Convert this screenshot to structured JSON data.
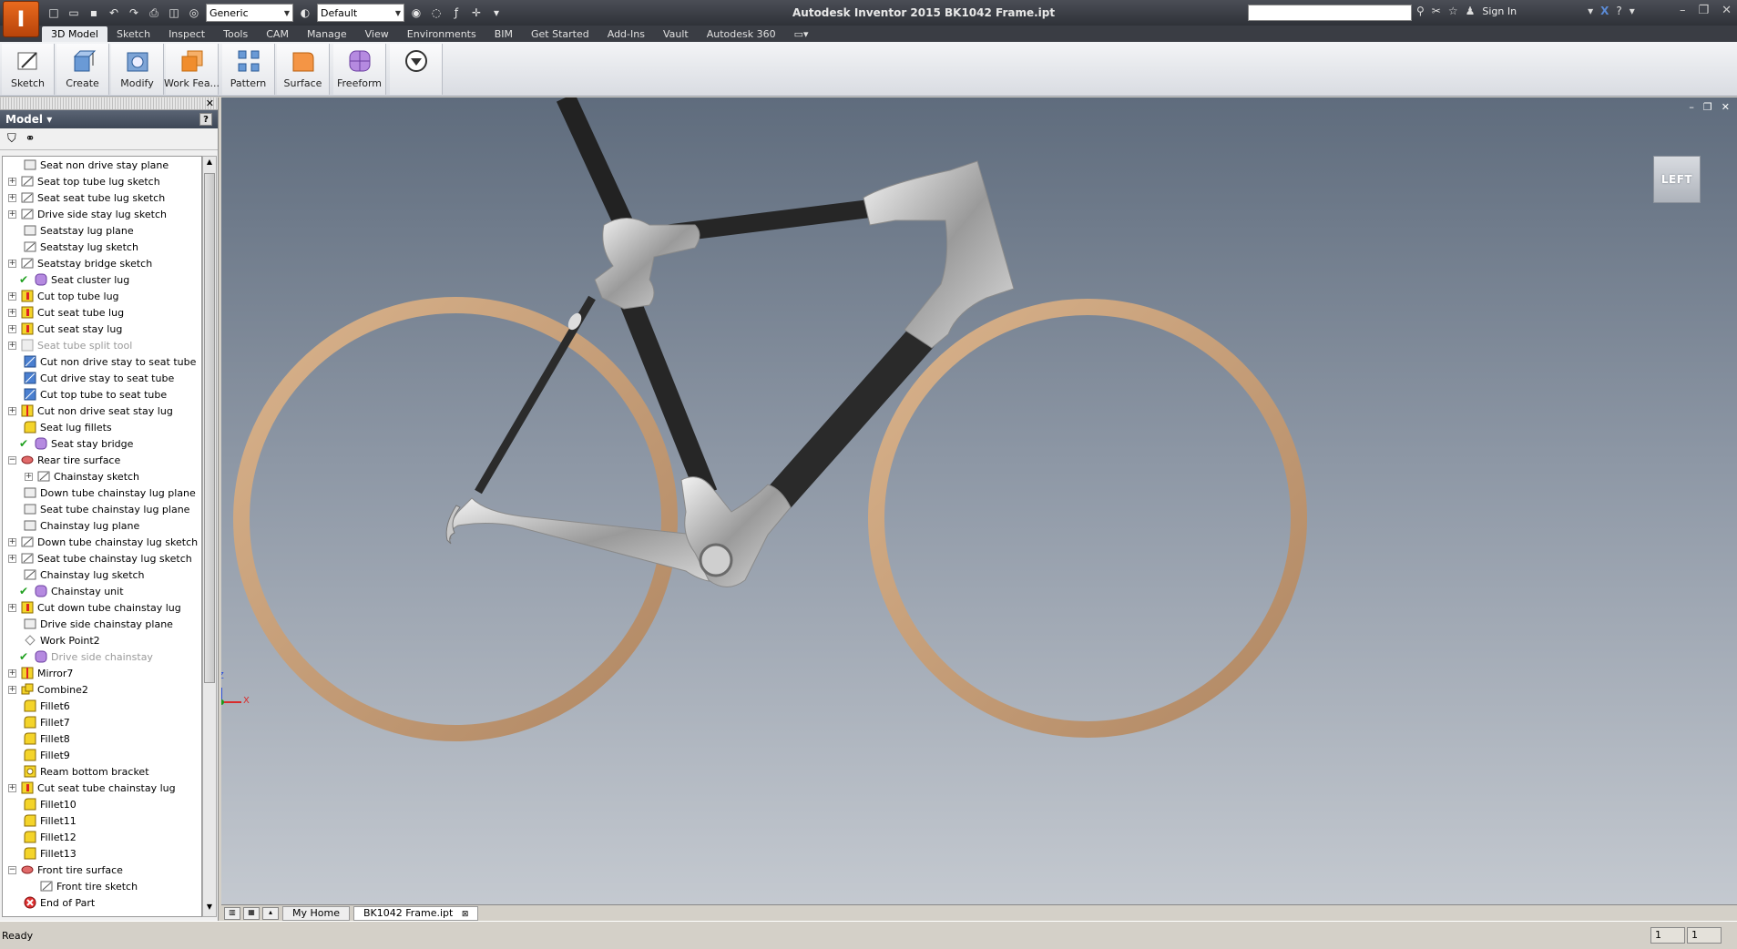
{
  "window": {
    "title": "Autodesk Inventor 2015   BK1042 Frame.ipt",
    "sign_in": "Sign In"
  },
  "quick_access": {
    "material": "Generic",
    "appearance": "Default",
    "icons": [
      "new-icon",
      "open-icon",
      "save-icon",
      "undo-icon",
      "redo-icon",
      "print-icon",
      "select-icon",
      "update-icon",
      "material-icon",
      "appearance-icon",
      "parameters-icon",
      "measure-icon",
      "customize-icon"
    ]
  },
  "tabs": [
    "3D Model",
    "Sketch",
    "Inspect",
    "Tools",
    "CAM",
    "Manage",
    "View",
    "Environments",
    "BIM",
    "Get Started",
    "Add-Ins",
    "Vault",
    "Autodesk 360"
  ],
  "active_tab": "3D Model",
  "ribbon": {
    "buttons": [
      {
        "label": "Sketch",
        "icon": "sketch-icon"
      },
      {
        "label": "Create",
        "icon": "create-icon"
      },
      {
        "label": "Modify",
        "icon": "modify-icon"
      },
      {
        "label": "Work Fea...",
        "icon": "work-features-icon"
      },
      {
        "label": "Pattern",
        "icon": "pattern-icon"
      },
      {
        "label": "Surface",
        "icon": "surface-icon"
      },
      {
        "label": "Freeform",
        "icon": "freeform-icon"
      },
      {
        "label": "",
        "icon": "more-icon"
      }
    ]
  },
  "browser": {
    "title": "Model",
    "items": [
      {
        "label": "Seat non drive stay plane",
        "icon": "plane-icon",
        "exp": "",
        "check": false,
        "dim": false
      },
      {
        "label": "Seat top tube lug sketch",
        "icon": "sketch-icon",
        "exp": "+",
        "check": false,
        "dim": false
      },
      {
        "label": "Seat seat tube lug sketch",
        "icon": "sketch-icon",
        "exp": "+",
        "check": false,
        "dim": false
      },
      {
        "label": "Drive side stay lug sketch",
        "icon": "sketch-icon",
        "exp": "+",
        "check": false,
        "dim": false
      },
      {
        "label": "Seatstay lug plane",
        "icon": "plane-icon",
        "exp": "",
        "check": false,
        "dim": false
      },
      {
        "label": "Seatstay lug sketch",
        "icon": "sketch-icon",
        "exp": "",
        "check": false,
        "dim": false
      },
      {
        "label": "Seatstay bridge sketch",
        "icon": "sketch-icon",
        "exp": "+",
        "check": false,
        "dim": false
      },
      {
        "label": "Seat cluster lug",
        "icon": "freeform-icon",
        "exp": "",
        "check": true,
        "dim": false
      },
      {
        "label": "Cut top tube lug",
        "icon": "cut-icon",
        "exp": "+",
        "check": false,
        "dim": false
      },
      {
        "label": "Cut seat tube lug",
        "icon": "cut-icon",
        "exp": "+",
        "check": false,
        "dim": false
      },
      {
        "label": "Cut seat stay lug",
        "icon": "cut-icon",
        "exp": "+",
        "check": false,
        "dim": false
      },
      {
        "label": "Seat tube split tool",
        "icon": "split-icon",
        "exp": "+",
        "check": false,
        "dim": true
      },
      {
        "label": "Cut non drive stay to seat tube",
        "icon": "split-cut-icon",
        "exp": "",
        "check": false,
        "dim": false
      },
      {
        "label": "Cut drive stay to seat tube",
        "icon": "split-cut-icon",
        "exp": "",
        "check": false,
        "dim": false
      },
      {
        "label": "Cut top tube to seat tube",
        "icon": "split-cut-icon",
        "exp": "",
        "check": false,
        "dim": false
      },
      {
        "label": "Cut non drive seat stay lug",
        "icon": "mirror-icon",
        "exp": "+",
        "check": false,
        "dim": false
      },
      {
        "label": "Seat lug fillets",
        "icon": "fillet-icon",
        "exp": "",
        "check": false,
        "dim": false
      },
      {
        "label": "Seat stay bridge",
        "icon": "freeform-icon",
        "exp": "",
        "check": true,
        "dim": false
      },
      {
        "label": "Rear tire surface",
        "icon": "revolve-icon",
        "exp": "-",
        "check": false,
        "dim": false
      },
      {
        "label": "Chainstay sketch",
        "icon": "sketch-icon",
        "exp": "+",
        "check": false,
        "dim": false,
        "indent": true
      },
      {
        "label": "Down tube chainstay lug plane",
        "icon": "plane-icon",
        "exp": "",
        "check": false,
        "dim": false
      },
      {
        "label": "Seat tube chainstay lug plane",
        "icon": "plane-icon",
        "exp": "",
        "check": false,
        "dim": false
      },
      {
        "label": "Chainstay lug plane",
        "icon": "plane-icon",
        "exp": "",
        "check": false,
        "dim": false
      },
      {
        "label": "Down tube chainstay lug sketch",
        "icon": "sketch-icon",
        "exp": "+",
        "check": false,
        "dim": false
      },
      {
        "label": "Seat tube chainstay lug sketch",
        "icon": "sketch-icon",
        "exp": "+",
        "check": false,
        "dim": false
      },
      {
        "label": "Chainstay lug sketch",
        "icon": "sketch-icon",
        "exp": "",
        "check": false,
        "dim": false
      },
      {
        "label": "Chainstay unit",
        "icon": "freeform-icon",
        "exp": "",
        "check": true,
        "dim": false
      },
      {
        "label": "Cut down tube chainstay lug",
        "icon": "cut-icon",
        "exp": "+",
        "check": false,
        "dim": false
      },
      {
        "label": "Drive side chainstay plane",
        "icon": "plane-icon",
        "exp": "",
        "check": false,
        "dim": false
      },
      {
        "label": "Work Point2",
        "icon": "workpoint-icon",
        "exp": "",
        "check": false,
        "dim": false
      },
      {
        "label": "Drive side chainstay",
        "icon": "freeform-icon",
        "exp": "",
        "check": true,
        "dim": true
      },
      {
        "label": "Mirror7",
        "icon": "mirror-icon",
        "exp": "+",
        "check": false,
        "dim": false
      },
      {
        "label": "Combine2",
        "icon": "combine-icon",
        "exp": "+",
        "check": false,
        "dim": false
      },
      {
        "label": "Fillet6",
        "icon": "fillet-icon",
        "exp": "",
        "check": false,
        "dim": false
      },
      {
        "label": "Fillet7",
        "icon": "fillet-icon",
        "exp": "",
        "check": false,
        "dim": false
      },
      {
        "label": "Fillet8",
        "icon": "fillet-icon",
        "exp": "",
        "check": false,
        "dim": false
      },
      {
        "label": "Fillet9",
        "icon": "fillet-icon",
        "exp": "",
        "check": false,
        "dim": false
      },
      {
        "label": "Ream bottom bracket",
        "icon": "hole-icon",
        "exp": "",
        "check": false,
        "dim": false
      },
      {
        "label": "Cut seat tube chainstay lug",
        "icon": "cut-icon",
        "exp": "+",
        "check": false,
        "dim": false
      },
      {
        "label": "Fillet10",
        "icon": "fillet-icon",
        "exp": "",
        "check": false,
        "dim": false
      },
      {
        "label": "Fillet11",
        "icon": "fillet-icon",
        "exp": "",
        "check": false,
        "dim": false
      },
      {
        "label": "Fillet12",
        "icon": "fillet-icon",
        "exp": "",
        "check": false,
        "dim": false
      },
      {
        "label": "Fillet13",
        "icon": "fillet-icon",
        "exp": "",
        "check": false,
        "dim": false
      },
      {
        "label": "Front tire surface",
        "icon": "revolve-icon",
        "exp": "-",
        "check": false,
        "dim": false
      },
      {
        "label": "Front tire sketch",
        "icon": "sketch-icon",
        "exp": "",
        "check": false,
        "dim": false,
        "indent": true
      },
      {
        "label": "End of Part",
        "icon": "end-of-part-icon",
        "exp": "",
        "check": false,
        "dim": false
      }
    ]
  },
  "viewport": {
    "viewcube_label": "LEFT",
    "axis_z": "Z",
    "axis_x": "X"
  },
  "doc_tabs": [
    "My Home",
    "BK1042 Frame.ipt"
  ],
  "status": {
    "text": "Ready",
    "cell1": "1",
    "cell2": "1"
  },
  "colors": {
    "tire": "#c8a27c",
    "tube": "#2a2a2a",
    "lug": "#c9c9c9"
  }
}
